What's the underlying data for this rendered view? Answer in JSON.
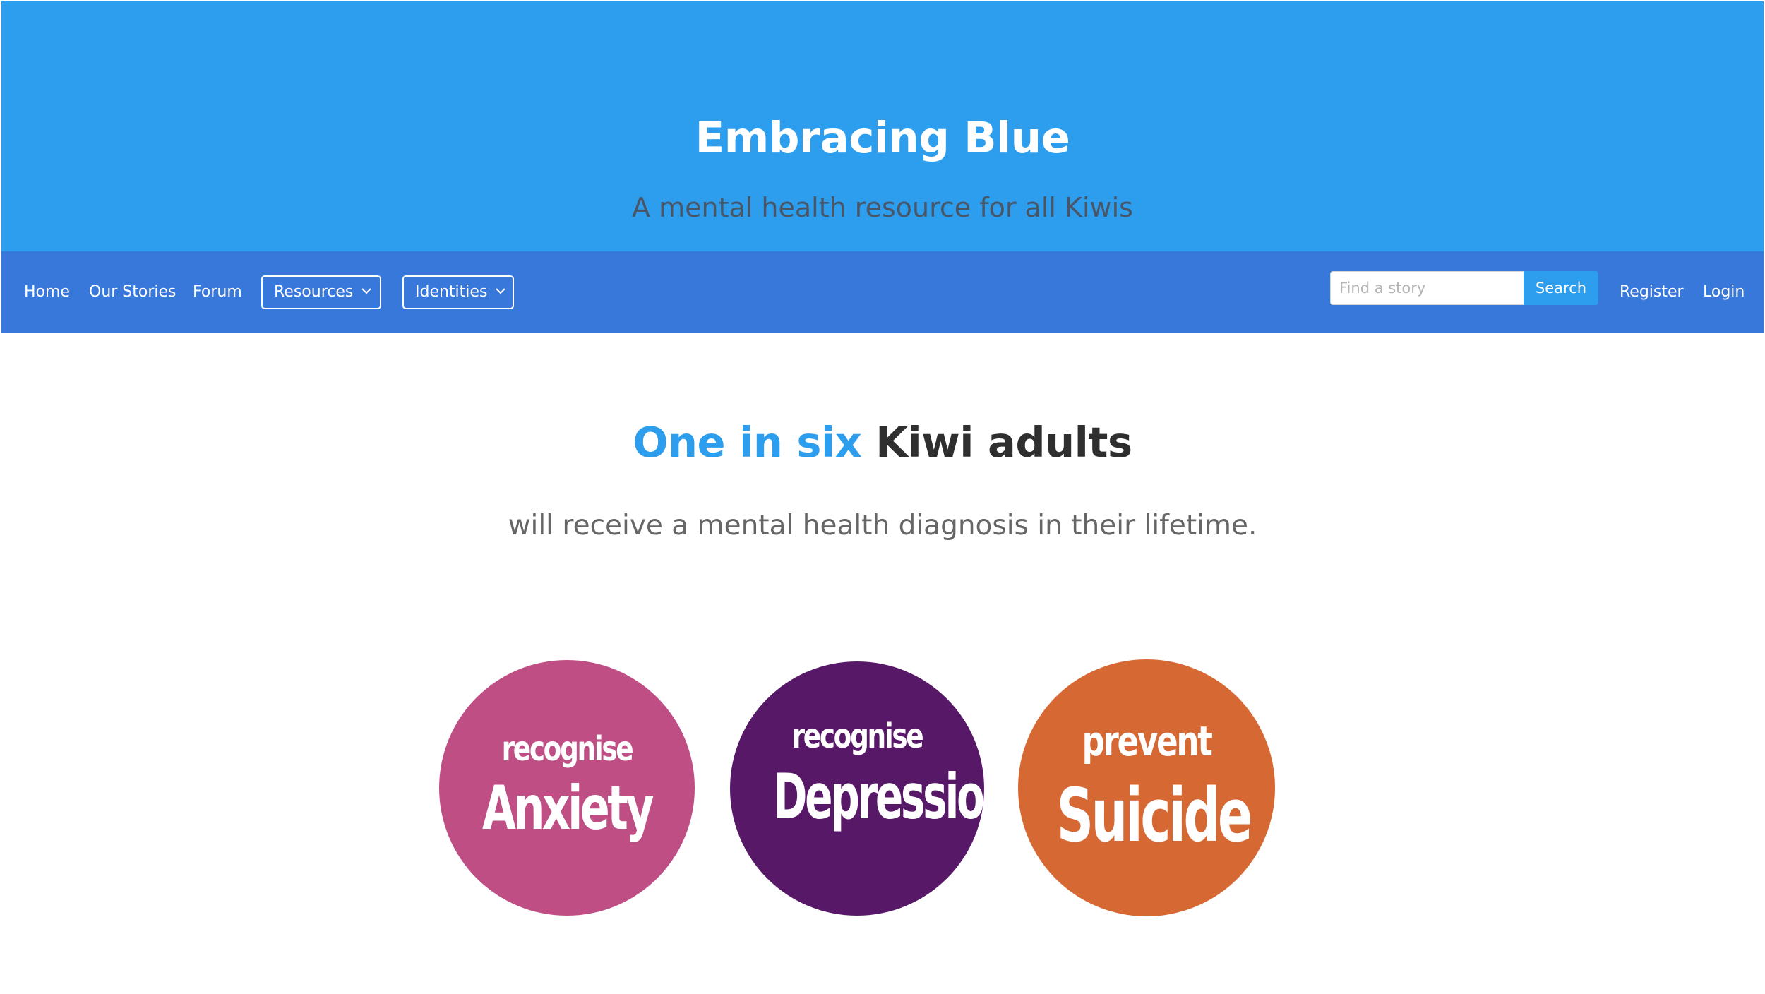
{
  "hero": {
    "title": "Embracing Blue",
    "subtitle": "A mental health resource for all Kiwis",
    "bg_color": "#2d9ded"
  },
  "navbar": {
    "bg_color": "#3878db",
    "links": {
      "home": "Home",
      "our_stories": "Our Stories",
      "forum": "Forum",
      "register": "Register",
      "login": "Login"
    },
    "dropdowns": {
      "resources": "Resources",
      "identities": "Identities"
    },
    "search": {
      "placeholder": "Find a story",
      "value": "",
      "button_label": "Search"
    }
  },
  "stat": {
    "highlight": "One in six",
    "rest": " Kiwi adults",
    "subtitle": "will receive a mental health diagnosis in their lifetime.",
    "accent_color": "#2d9ded"
  },
  "circles": [
    {
      "verb": "recognise",
      "noun": "Anxiety",
      "color": "#bf4e85"
    },
    {
      "verb": "recognise",
      "noun": "Depression",
      "color": "#581868"
    },
    {
      "verb": "prevent",
      "noun": "Suicide",
      "color": "#d66833"
    }
  ],
  "icons": {
    "dropdown_caret": "chevron-down-icon"
  }
}
